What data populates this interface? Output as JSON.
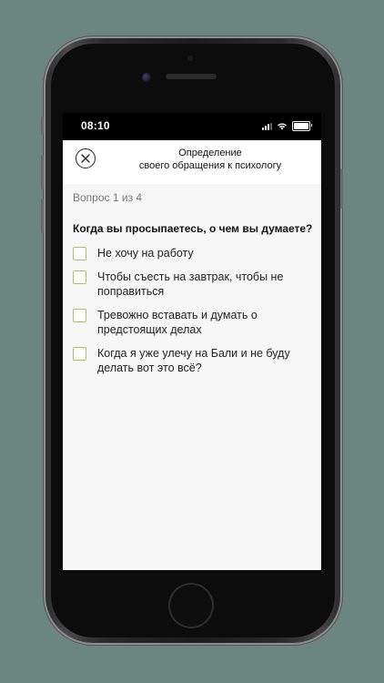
{
  "status_bar": {
    "time": "08:10",
    "icons": [
      "signal-icon",
      "wifi-icon",
      "battery-icon"
    ]
  },
  "header": {
    "title_line1": "Определение",
    "title_line2": "своего обращения к психологу",
    "close_icon": "close-icon"
  },
  "quiz": {
    "progress": "Вопрос 1 из 4",
    "question": "Когда вы просыпаетесь, о чем вы думаете?",
    "options": [
      {
        "label": "Не хочу на работу"
      },
      {
        "label": "Чтобы съесть на завтрак, чтобы не поправиться"
      },
      {
        "label": "Тревожно вставать и думать о предстоящих делах"
      },
      {
        "label": "Когда я уже улечу на Бали и не буду делать вот это всё?"
      }
    ]
  },
  "colors": {
    "background": "#6b8580",
    "checkbox_border": "#a9c25f",
    "content_bg": "#f7f7f7"
  }
}
